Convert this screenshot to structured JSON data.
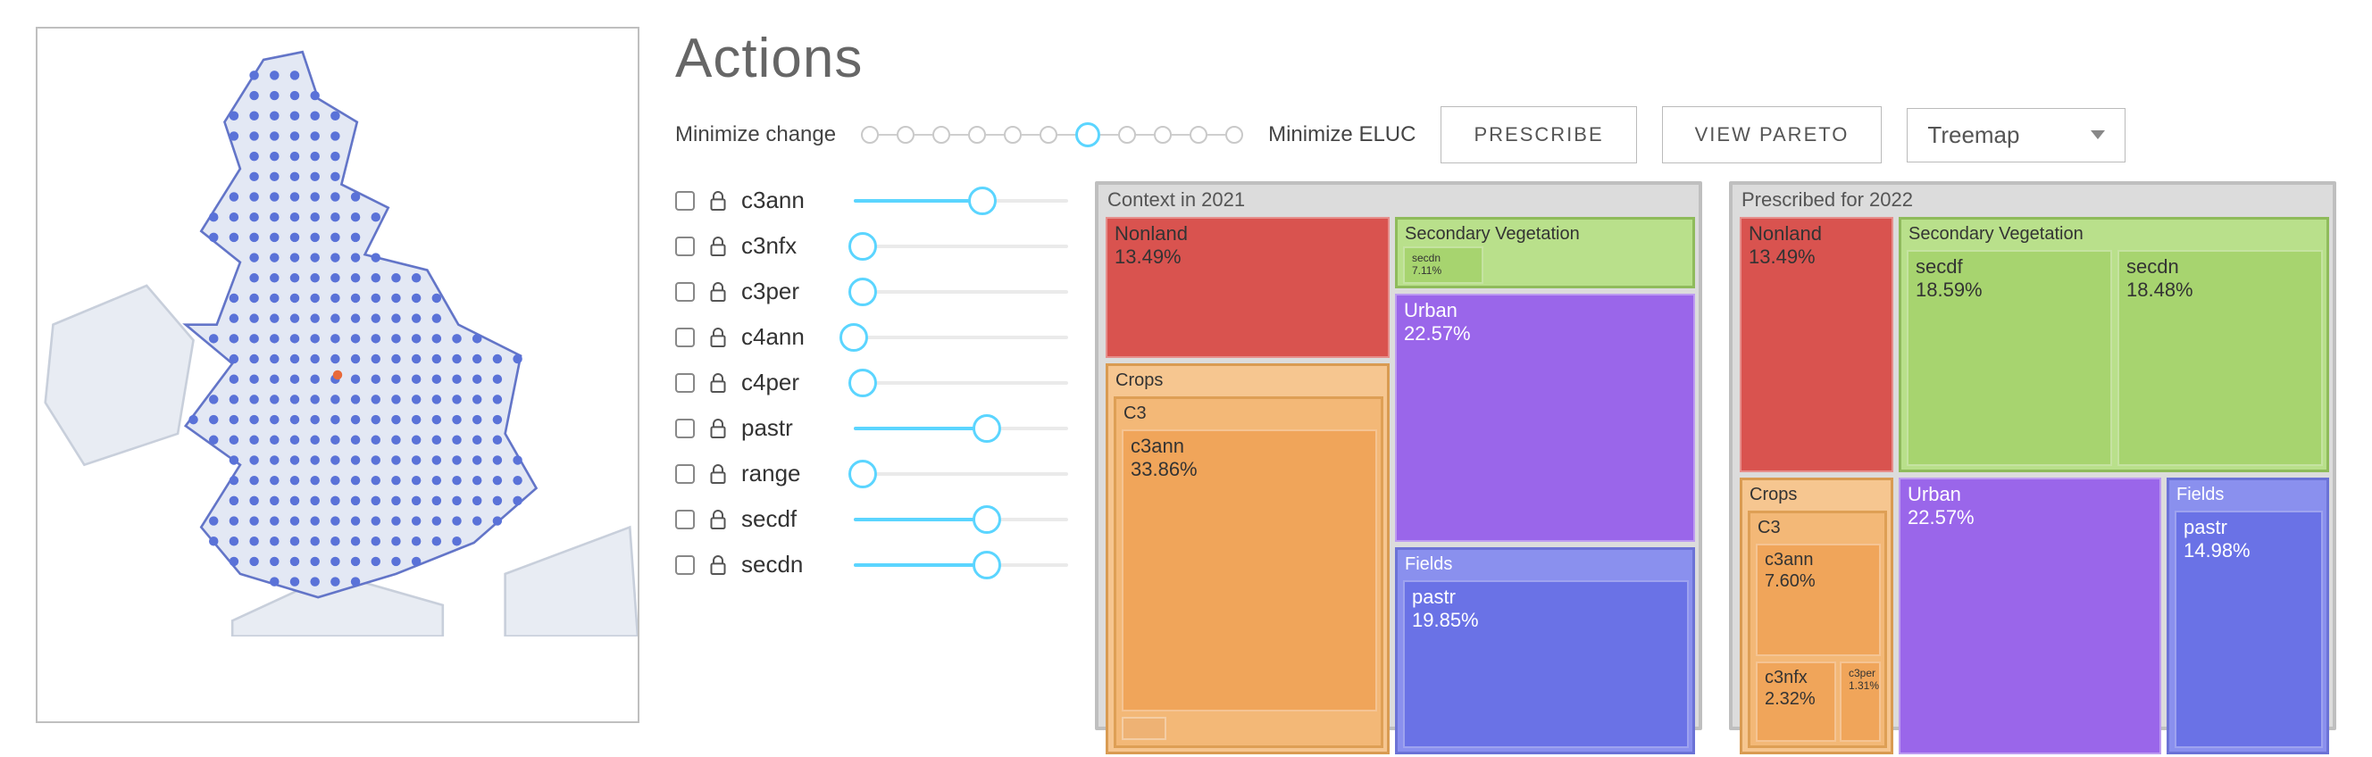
{
  "title": "Actions",
  "toprow": {
    "minimize_change": "Minimize change",
    "minimize_eluc": "Minimize ELUC",
    "slider_steps": 11,
    "slider_active": 6,
    "prescribe": "PRESCRIBE",
    "view_pareto": "VIEW PARETO",
    "view_mode": "Treemap"
  },
  "sliders": [
    {
      "name": "c3ann",
      "pct": 60
    },
    {
      "name": "c3nfx",
      "pct": 4
    },
    {
      "name": "c3per",
      "pct": 4
    },
    {
      "name": "c4ann",
      "pct": 0
    },
    {
      "name": "c4per",
      "pct": 4
    },
    {
      "name": "pastr",
      "pct": 62
    },
    {
      "name": "range",
      "pct": 4
    },
    {
      "name": "secdf",
      "pct": 62
    },
    {
      "name": "secdn",
      "pct": 62
    }
  ],
  "treemap_left": {
    "title": "Context in 2021",
    "nonland": {
      "label": "Nonland",
      "pct": "13.49%"
    },
    "secveg": {
      "label": "Secondary Vegetation",
      "secdn": {
        "label": "secdn",
        "pct": "7.11%"
      }
    },
    "urban": {
      "label": "Urban",
      "pct": "22.57%"
    },
    "crops": {
      "label": "Crops",
      "c3": {
        "label": "C3",
        "c3ann": {
          "label": "c3ann",
          "pct": "33.86%"
        }
      }
    },
    "fields": {
      "label": "Fields",
      "pastr": {
        "label": "pastr",
        "pct": "19.85%"
      }
    }
  },
  "treemap_right": {
    "title": "Prescribed for 2022",
    "nonland": {
      "label": "Nonland",
      "pct": "13.49%"
    },
    "secveg": {
      "label": "Secondary Vegetation",
      "secdf": {
        "label": "secdf",
        "pct": "18.59%"
      },
      "secdn": {
        "label": "secdn",
        "pct": "18.48%"
      }
    },
    "urban": {
      "label": "Urban",
      "pct": "22.57%"
    },
    "crops": {
      "label": "Crops",
      "c3": {
        "label": "C3"
      },
      "c3ann": {
        "label": "c3ann",
        "pct": "7.60%"
      },
      "c3nfx": {
        "label": "c3nfx",
        "pct": "2.32%"
      },
      "c3per": {
        "label": "c3per",
        "pct": "1.31%"
      }
    },
    "fields": {
      "label": "Fields",
      "pastr": {
        "label": "pastr",
        "pct": "14.98%"
      }
    }
  },
  "chart_data": [
    {
      "type": "treemap",
      "title": "Context in 2021",
      "series": [
        {
          "name": "Nonland",
          "value": 13.49,
          "color": "#d9534f"
        },
        {
          "name": "Secondary Vegetation / secdn",
          "value": 7.11,
          "color": "#a7d46f"
        },
        {
          "name": "Urban",
          "value": 22.57,
          "color": "#8a54e6"
        },
        {
          "name": "Crops / C3 / c3ann",
          "value": 33.86,
          "color": "#f0a55a"
        },
        {
          "name": "Fields / pastr",
          "value": 19.85,
          "color": "#6a72e6"
        }
      ]
    },
    {
      "type": "treemap",
      "title": "Prescribed for 2022",
      "series": [
        {
          "name": "Nonland",
          "value": 13.49,
          "color": "#d9534f"
        },
        {
          "name": "Secondary Vegetation / secdf",
          "value": 18.59,
          "color": "#a7d46f"
        },
        {
          "name": "Secondary Vegetation / secdn",
          "value": 18.48,
          "color": "#a7d46f"
        },
        {
          "name": "Urban",
          "value": 22.57,
          "color": "#8a54e6"
        },
        {
          "name": "Crops / C3 / c3ann",
          "value": 7.6,
          "color": "#f0a55a"
        },
        {
          "name": "Crops / C3 / c3nfx",
          "value": 2.32,
          "color": "#f0a55a"
        },
        {
          "name": "Crops / C3 / c3per",
          "value": 1.31,
          "color": "#f0a55a"
        },
        {
          "name": "Fields / pastr",
          "value": 14.98,
          "color": "#6a72e6"
        }
      ]
    }
  ],
  "map": {
    "region": "UK",
    "highlight_point": [
      0.5,
      0.57
    ]
  }
}
